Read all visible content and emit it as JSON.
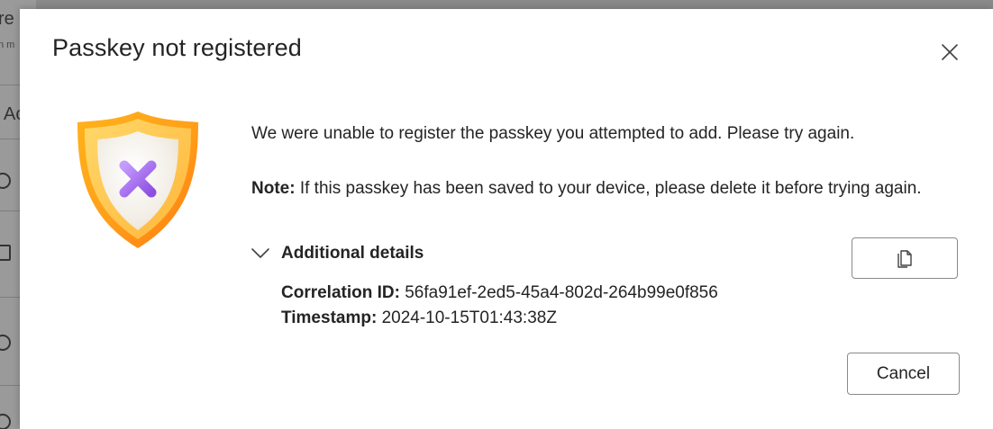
{
  "background": {
    "fragment_1": "re",
    "fragment_2": "n m",
    "fragment_3": "Ac"
  },
  "dialog": {
    "title": "Passkey not registered",
    "close_icon": "close-icon",
    "illustration_icon": "shield-error-icon",
    "message": "We were unable to register the passkey you attempted to add. Please try again.",
    "note_label": "Note:",
    "note_text": " If this passkey has been saved to your device, please delete it before trying again.",
    "details": {
      "toggle_label": "Additional details",
      "expanded": true,
      "toggle_icon": "chevron-down-icon",
      "copy_icon": "copy-icon",
      "correlation_label": "Correlation ID:",
      "correlation_value": " 56fa91ef-2ed5-45a4-802d-264b99e0f856",
      "timestamp_label": "Timestamp:",
      "timestamp_value": " 2024-10-15T01:43:38Z"
    },
    "cancel_label": "Cancel"
  },
  "colors": {
    "shield_outer": "#f5a623",
    "shield_inner": "#f3efe6",
    "x_mark": "#a56be8",
    "text": "#242424",
    "border": "#8a8a8a"
  }
}
